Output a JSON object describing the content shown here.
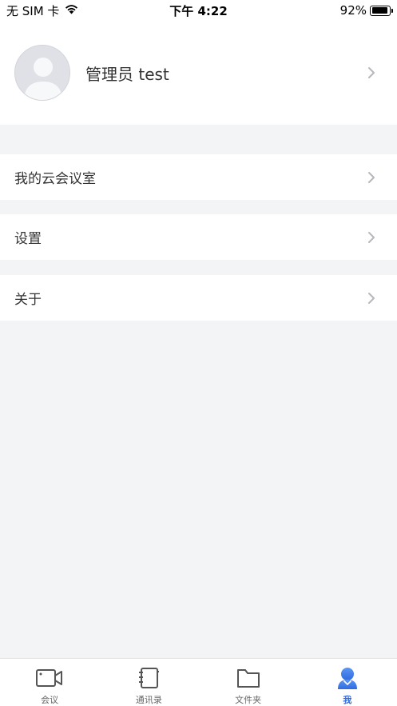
{
  "status_bar": {
    "carrier": "无 SIM 卡",
    "time": "下午 4:22",
    "battery_percent": "92%",
    "battery_level": 0.92
  },
  "profile": {
    "name": "管理员 test",
    "avatar_icon": "user-avatar-icon",
    "chevron_icon": "chevron-right-icon"
  },
  "menu": {
    "items": [
      {
        "label": "我的云会议室",
        "icon": "chevron-right-icon"
      },
      {
        "label": "设置",
        "icon": "chevron-right-icon"
      },
      {
        "label": "关于",
        "icon": "chevron-right-icon"
      }
    ]
  },
  "tab_bar": {
    "active_index": 3,
    "active_color": "#2f6bdf",
    "inactive_color": "#666666",
    "tabs": [
      {
        "label": "会议",
        "icon": "video-camera-icon"
      },
      {
        "label": "通讯录",
        "icon": "address-book-icon"
      },
      {
        "label": "文件夹",
        "icon": "folder-icon"
      },
      {
        "label": "我",
        "icon": "person-icon"
      }
    ]
  }
}
